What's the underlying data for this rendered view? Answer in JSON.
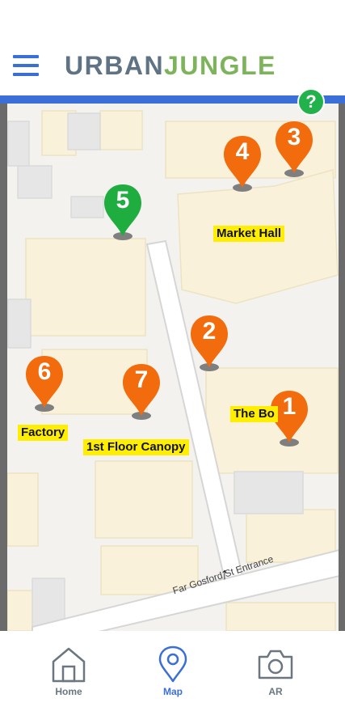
{
  "app": {
    "brand_part1": "URBAN",
    "brand_part2": "JUNGLE",
    "help_label": "?"
  },
  "colors": {
    "accent": "#3a6fd8",
    "brand_gray": "#5f7385",
    "brand_green": "#7db35b",
    "pin_orange": "#f26c0d",
    "pin_green": "#20ad3f",
    "label_bg": "#ffee00"
  },
  "map": {
    "pins": [
      {
        "number": "1",
        "color": "orange"
      },
      {
        "number": "2",
        "color": "orange"
      },
      {
        "number": "3",
        "color": "orange"
      },
      {
        "number": "4",
        "color": "orange"
      },
      {
        "number": "5",
        "color": "green"
      },
      {
        "number": "6",
        "color": "orange"
      },
      {
        "number": "7",
        "color": "orange"
      }
    ],
    "labels": {
      "market_hall": "Market Hall",
      "the_bo": "The Bo",
      "factory": "Factory",
      "canopy": "1st Floor Canopy",
      "road": "Far Gosford St Entrance"
    },
    "entrance_arrow": "↑"
  },
  "tabs": [
    {
      "label": "Home",
      "icon": "home-icon",
      "active": false
    },
    {
      "label": "Map",
      "icon": "map-pin-icon",
      "active": true
    },
    {
      "label": "AR",
      "icon": "camera-icon",
      "active": false
    }
  ]
}
